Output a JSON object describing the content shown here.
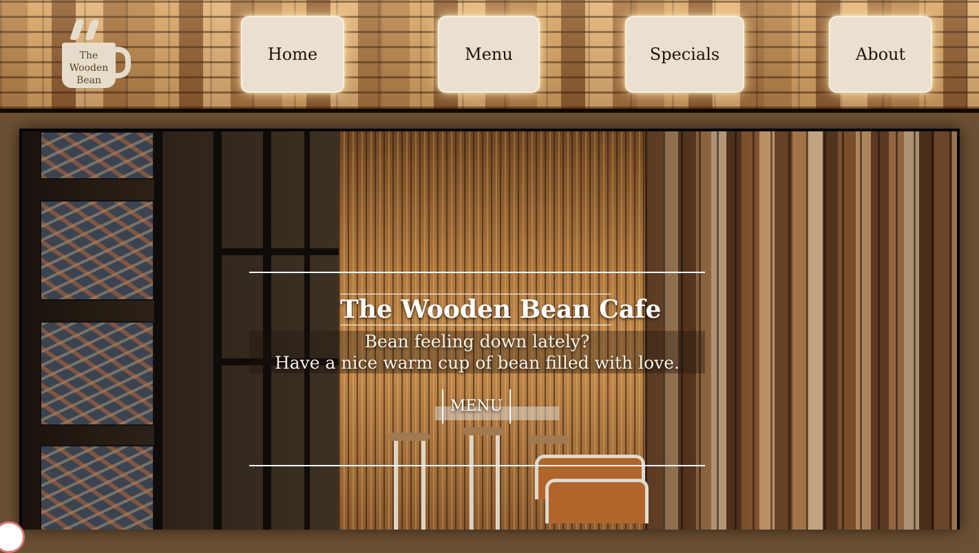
{
  "logo": {
    "line1": "The",
    "line2": "Wooden",
    "line3": "Bean"
  },
  "nav": {
    "items": [
      {
        "label": "Home"
      },
      {
        "label": "Menu"
      },
      {
        "label": "Specials"
      },
      {
        "label": "About"
      }
    ]
  },
  "hero": {
    "title": "The Wooden Bean Cafe",
    "subtitle_line1": "Bean feeling down lately?",
    "subtitle_line2": "Have a nice warm cup of bean filled with love.",
    "button_label": "MENU"
  },
  "colors": {
    "nav_button_bg": "#ebe0d0",
    "nav_button_text": "#1c140c",
    "hero_text": "#ffffff",
    "frame_border": "#050505",
    "page_bg": "#6b5033"
  },
  "icons": {
    "logo": "coffee-cup-icon"
  }
}
